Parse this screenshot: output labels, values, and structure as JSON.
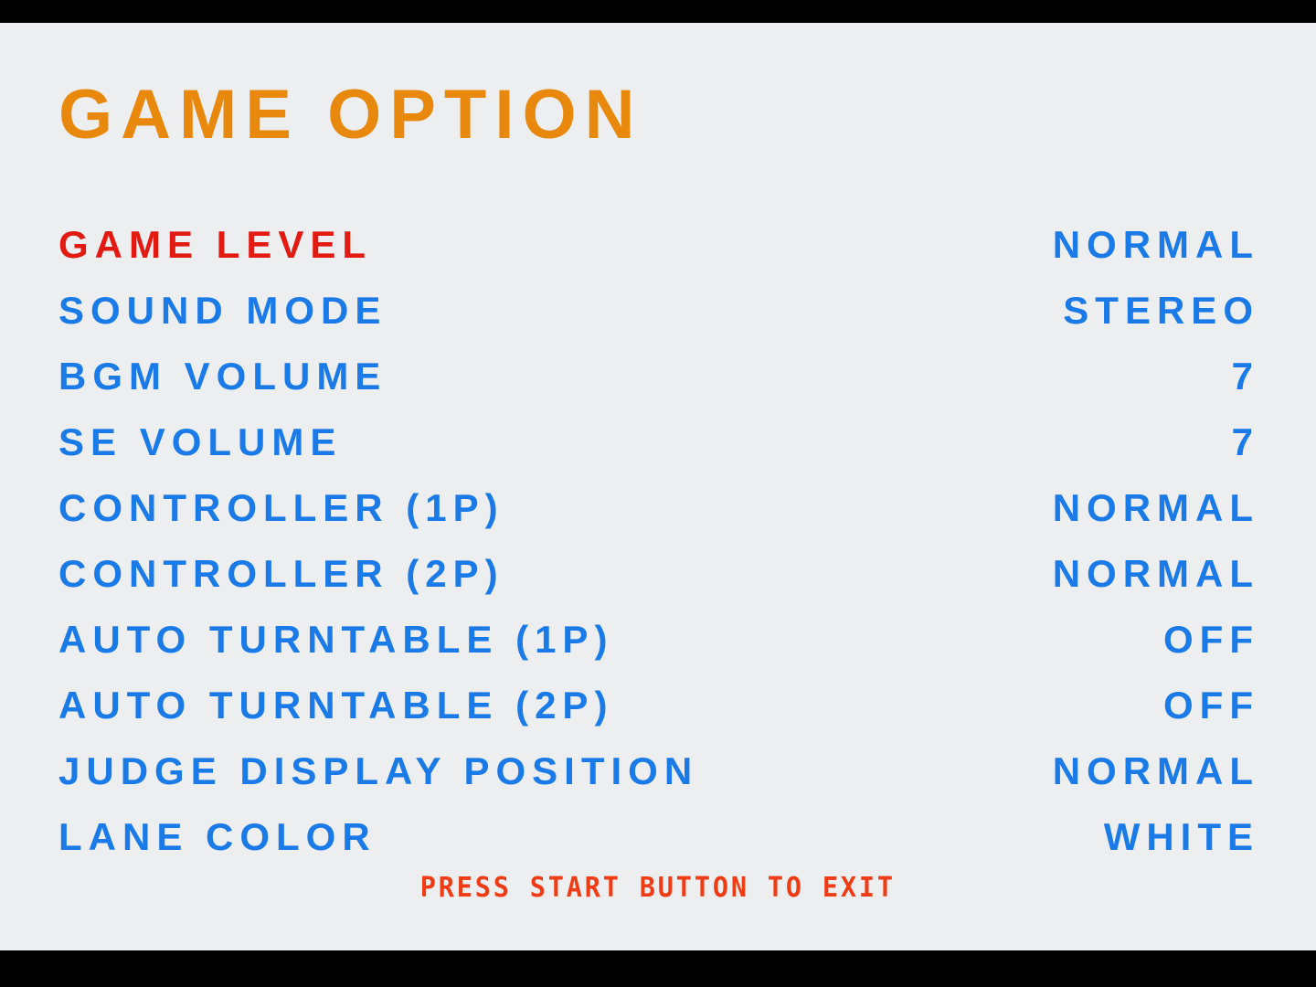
{
  "screen": {
    "background_color": "#edeef0",
    "letterbox_color": "#000000",
    "title": "GAME OPTION",
    "title_color": "#e8880c",
    "label_color": "#1a7ae8",
    "selected_color": "#e21a12",
    "footer_color": "#f03c14"
  },
  "menu": {
    "rows": [
      {
        "label": "GAME LEVEL",
        "value": "NORMAL",
        "selected": true
      },
      {
        "label": "SOUND MODE",
        "value": "STEREO",
        "selected": false
      },
      {
        "label": "BGM VOLUME",
        "value": "7",
        "selected": false
      },
      {
        "label": "SE VOLUME",
        "value": "7",
        "selected": false
      },
      {
        "label": "CONTROLLER (1P)",
        "value": "NORMAL",
        "selected": false
      },
      {
        "label": "CONTROLLER (2P)",
        "value": "NORMAL",
        "selected": false
      },
      {
        "label": "AUTO TURNTABLE (1P)",
        "value": "OFF",
        "selected": false
      },
      {
        "label": "AUTO TURNTABLE (2P)",
        "value": "OFF",
        "selected": false
      },
      {
        "label": "JUDGE DISPLAY POSITION",
        "value": "NORMAL",
        "selected": false
      },
      {
        "label": "LANE COLOR",
        "value": "WHITE",
        "selected": false
      }
    ]
  },
  "footer": {
    "hint": "PRESS START BUTTON TO EXIT"
  }
}
